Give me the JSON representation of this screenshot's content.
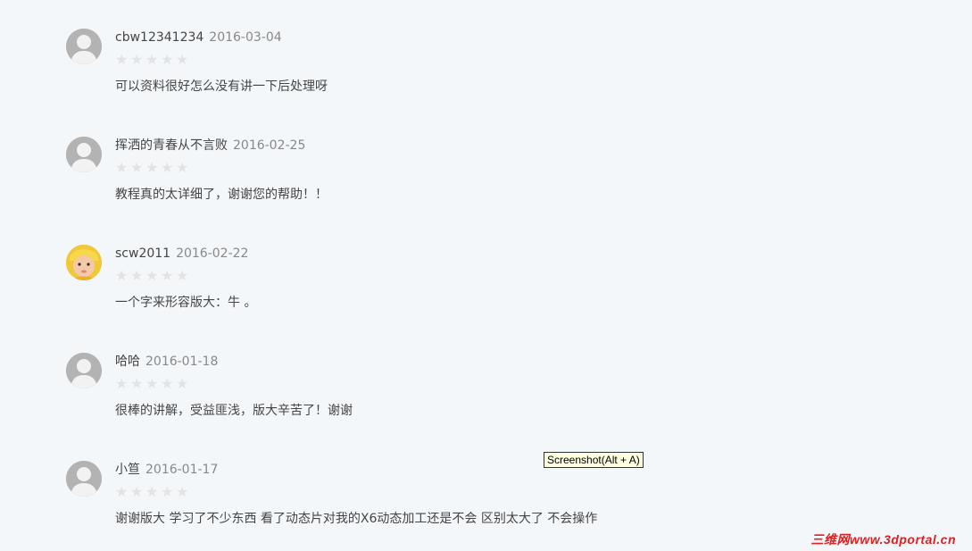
{
  "comments": [
    {
      "username": "cbw12341234",
      "date": "2016-03-04",
      "rating": 0,
      "stars": [
        "★",
        "★",
        "★",
        "★",
        "★"
      ],
      "text": "可以资料很好怎么没有讲一下后处理呀",
      "avatar": "default-user-icon"
    },
    {
      "username": "挥洒的青春从不言败",
      "date": "2016-02-25",
      "rating": 0,
      "stars": [
        "★",
        "★",
        "★",
        "★",
        "★"
      ],
      "text": "教程真的太详细了，谢谢您的帮助！！",
      "avatar": "default-user-icon"
    },
    {
      "username": "scw2011",
      "date": "2016-02-22",
      "rating": 0,
      "stars": [
        "★",
        "★",
        "★",
        "★",
        "★"
      ],
      "text": "一个字来形容版大：牛 。",
      "avatar": "baby-photo"
    },
    {
      "username": "哈哈",
      "date": "2016-01-18",
      "rating": 0,
      "stars": [
        "★",
        "★",
        "★",
        "★",
        "★"
      ],
      "text": "很棒的讲解，受益匪浅，版大辛苦了！谢谢",
      "avatar": "default-user-icon"
    },
    {
      "username": "小笪",
      "date": "2016-01-17",
      "rating": 0,
      "stars": [
        "★",
        "★",
        "★",
        "★",
        "★"
      ],
      "text": "谢谢版大 学习了不少东西 看了动态片对我的X6动态加工还是不会 区别太大了 不会操作",
      "avatar": "default-user-icon"
    }
  ],
  "tooltip": "Screenshot(Alt + A)",
  "watermark": "三维网www.3dportal.cn",
  "colors": {
    "background": "#f4f7fa",
    "star_empty": "#e3e3e3",
    "avatar_default": "#b3b3b3",
    "watermark": "#e02020"
  }
}
